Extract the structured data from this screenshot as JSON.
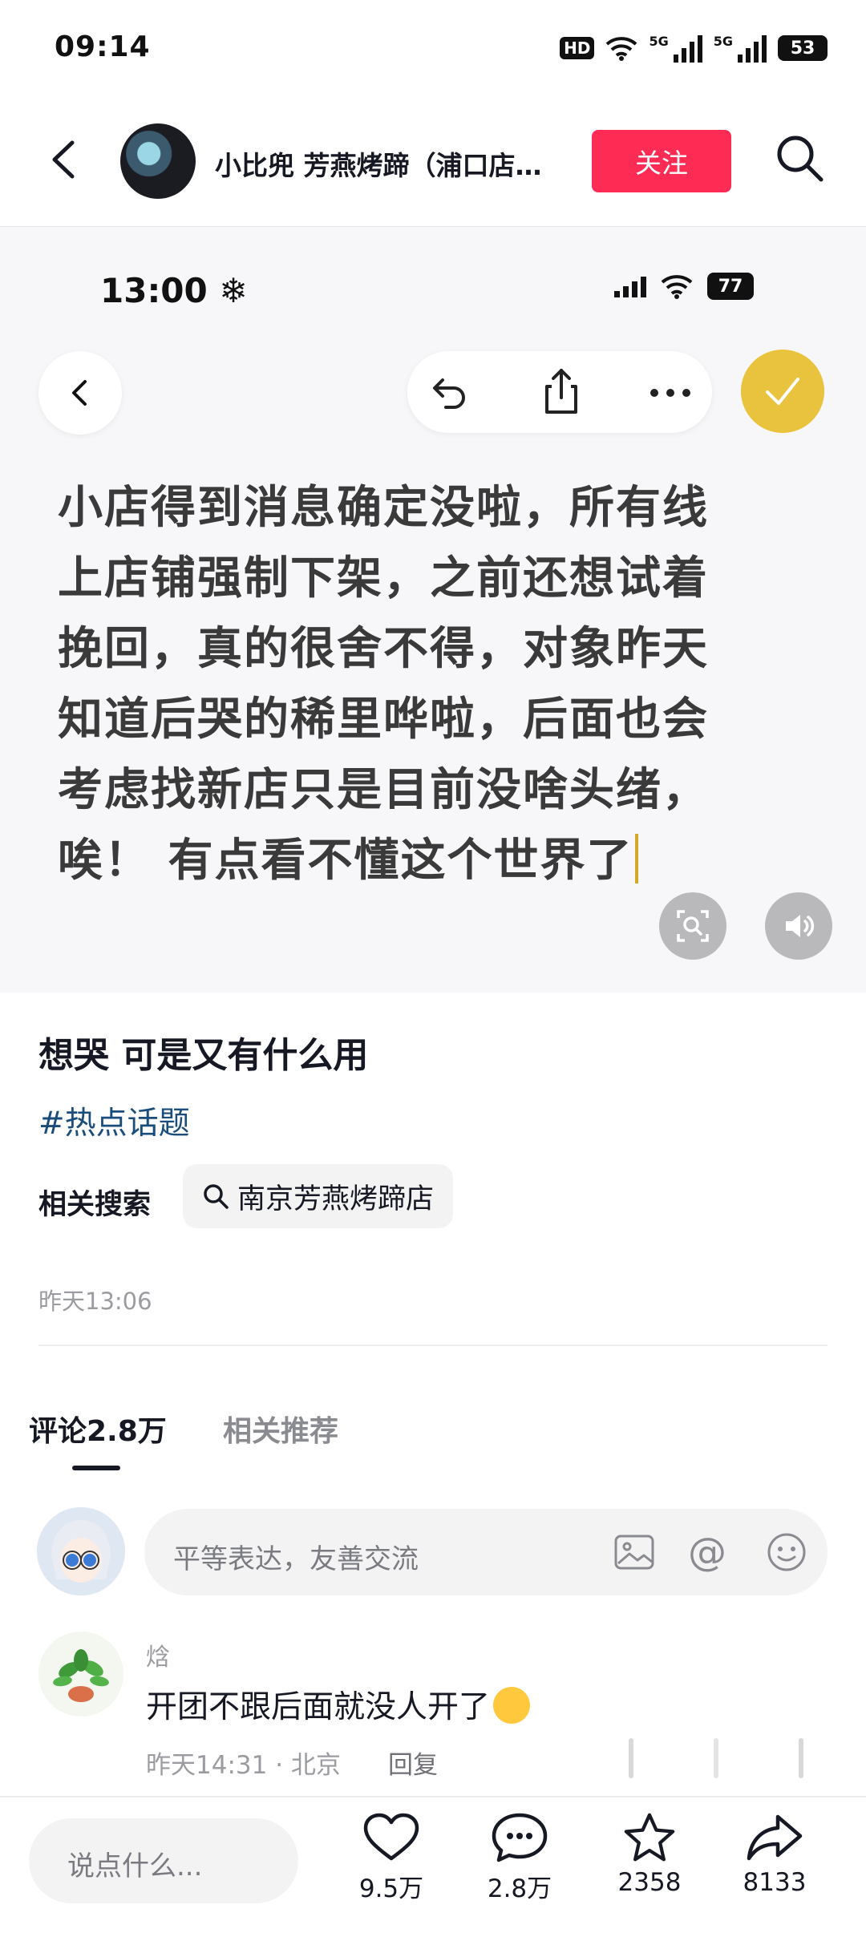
{
  "status_bar": {
    "time": "09:14",
    "hd_label": "HD",
    "net1": "5G",
    "net2": "5G",
    "battery": "53"
  },
  "header": {
    "author_name": "小比兜 芳燕烤蹄（浦口店…",
    "follow_label": "关注"
  },
  "photo": {
    "phone_time": "13:00",
    "phone_battery": "77",
    "note_lines": [
      "小店得到消息确定没啦，所有线",
      "上店铺强制下架，之前还想试着",
      "挽回，真的很舍不得，对象昨天",
      "知道后哭的稀里哗啦，后面也会",
      "考虑找新店只是目前没啥头绪，",
      "唉！ 有点看不懂这个世界了"
    ]
  },
  "post": {
    "title": "想哭 可是又有什么用",
    "hashtag": "#热点话题",
    "related_label": "相关搜索",
    "related_query": "南京芳燕烤蹄店",
    "date": "昨天13:06"
  },
  "tabs": {
    "comments": "评论2.8万",
    "related": "相关推荐"
  },
  "comment_input": {
    "placeholder": "平等表达，友善交流",
    "at_symbol": "@"
  },
  "comments": [
    {
      "user": "焓",
      "text": "开团不跟后面就没人开了",
      "time_location": "昨天14:31 · 北京",
      "reply_label": "回复"
    }
  ],
  "bottom_bar": {
    "say_placeholder": "说点什么...",
    "likes": "9.5万",
    "comments": "2.8万",
    "favorites": "2358",
    "shares": "8133"
  },
  "colors": {
    "follow_button": "#fe2c55",
    "hashtag": "#1a4d7c",
    "check_button": "#e9c33e"
  }
}
